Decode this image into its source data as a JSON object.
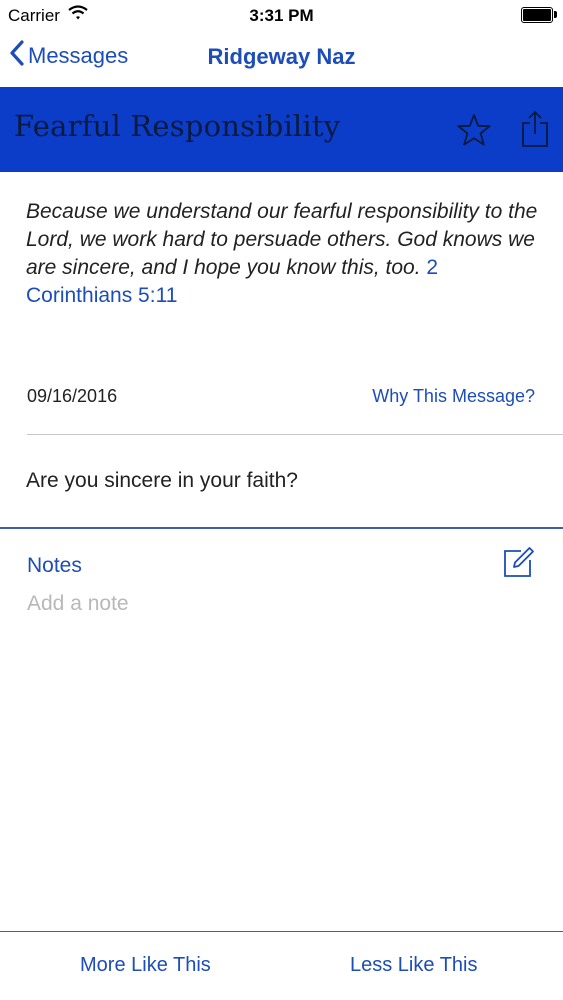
{
  "status_bar": {
    "carrier": "Carrier",
    "time": "3:31 PM",
    "icons": [
      "wifi-icon",
      "battery-icon"
    ]
  },
  "nav": {
    "back_label": "Messages",
    "title": "Ridgeway Naz"
  },
  "header": {
    "title": "Fearful Responsibility",
    "background_color": "#0b3dc9",
    "icons": [
      "star-icon",
      "share-icon"
    ]
  },
  "message": {
    "verse_text": "Because we understand our fearful responsibility to the Lord, we work hard to persuade others. God knows we are sincere, and I hope you know this, too.",
    "verse_reference": "2 Corinthians 5:11",
    "date": "09/16/2016",
    "why_link": "Why This Message?",
    "question": "Are you sincere in your faith?"
  },
  "notes": {
    "heading": "Notes",
    "placeholder": "Add a note",
    "value": ""
  },
  "footer": {
    "more_label": "More Like This",
    "less_label": "Less Like This"
  },
  "accent_color": "#1d4db8"
}
